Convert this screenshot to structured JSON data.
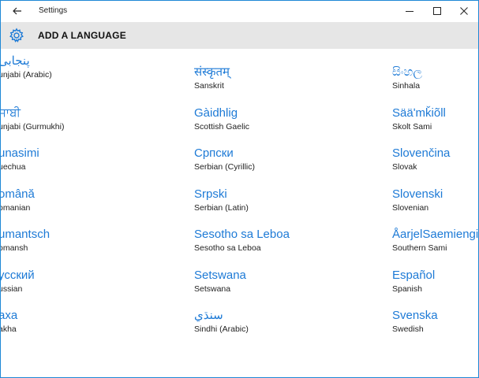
{
  "window": {
    "title": "Settings"
  },
  "header": {
    "title": "ADD A LANGUAGE"
  },
  "columns": [
    [
      {
        "native": "ﭘﻨﺠﺎﺑﯽ",
        "english": "unjabi (Arabic)"
      },
      {
        "native": "ਜਾਬੀ",
        "english": "unjabi (Gurmukhi)"
      },
      {
        "native": "unasimi",
        "english": "uechua"
      },
      {
        "native": "omână",
        "english": "omanian"
      },
      {
        "native": "umantsch",
        "english": "omansh"
      },
      {
        "native": "усский",
        "english": "ussian"
      },
      {
        "native": "axa",
        "english": "akha"
      }
    ],
    [
      {
        "native": "संस्कृतम्",
        "english": "Sanskrit"
      },
      {
        "native": "Gàidhlig",
        "english": "Scottish Gaelic"
      },
      {
        "native": "Српски",
        "english": "Serbian (Cyrillic)"
      },
      {
        "native": "Srpski",
        "english": "Serbian (Latin)"
      },
      {
        "native": "Sesotho sa Leboa",
        "english": "Sesotho sa Leboa"
      },
      {
        "native": "Setswana",
        "english": "Setswana"
      },
      {
        "native": "سنڌي",
        "english": "Sindhi (Arabic)"
      }
    ],
    [
      {
        "native": "සිංහල",
        "english": "Sinhala"
      },
      {
        "native": "Sääʹmǩiõll",
        "english": "Skolt Sami"
      },
      {
        "native": "Slovenčina",
        "english": "Slovak"
      },
      {
        "native": "Slovenski",
        "english": "Slovenian"
      },
      {
        "native": "ÅarjelSaemiengiele",
        "english": "Southern Sami"
      },
      {
        "native": "Español",
        "english": "Spanish"
      },
      {
        "native": "Svenska",
        "english": "Swedish"
      }
    ]
  ]
}
